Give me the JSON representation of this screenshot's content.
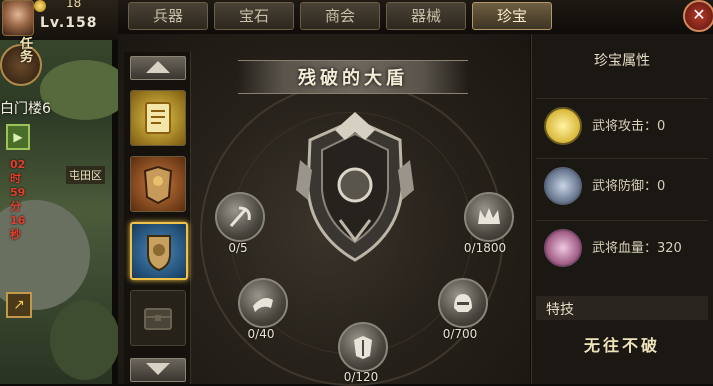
{
  "hud": {
    "coin_count": "18",
    "level": "Lv.158",
    "task_label": "任务",
    "gate_label": "白门楼6",
    "timer_text": "02时59分16秒",
    "tuntian_label": "屯田区"
  },
  "tabs": [
    {
      "label": "兵器",
      "active": false
    },
    {
      "label": "宝石",
      "active": false
    },
    {
      "label": "商会",
      "active": false
    },
    {
      "label": "器械",
      "active": false
    },
    {
      "label": "珍宝",
      "active": true
    }
  ],
  "treasure": {
    "name": "残破的大盾",
    "slots": [
      {
        "type": "scroll-book",
        "selected": false
      },
      {
        "type": "armor",
        "selected": false
      },
      {
        "type": "shield",
        "selected": true
      },
      {
        "type": "chest-locked",
        "selected": false
      }
    ],
    "gems": [
      {
        "icon": "axe-gem-icon",
        "count": "0/5"
      },
      {
        "icon": "crown-gem-icon",
        "count": "0/1800"
      },
      {
        "icon": "bracer-gem-icon",
        "count": "0/40"
      },
      {
        "icon": "helmet-gem-icon",
        "count": "0/700"
      },
      {
        "icon": "armor-gem-icon",
        "count": "0/120"
      }
    ]
  },
  "attributes": {
    "title": "珍宝属性",
    "rows": [
      {
        "label": "武将攻击：0",
        "color": "#e8c93a"
      },
      {
        "label": "武将防御：0",
        "color": "#7a8ca8"
      },
      {
        "label": "武将血量：320",
        "color": "#b06a9a"
      }
    ]
  },
  "skill": {
    "header": "特技",
    "name": "无往不破"
  }
}
